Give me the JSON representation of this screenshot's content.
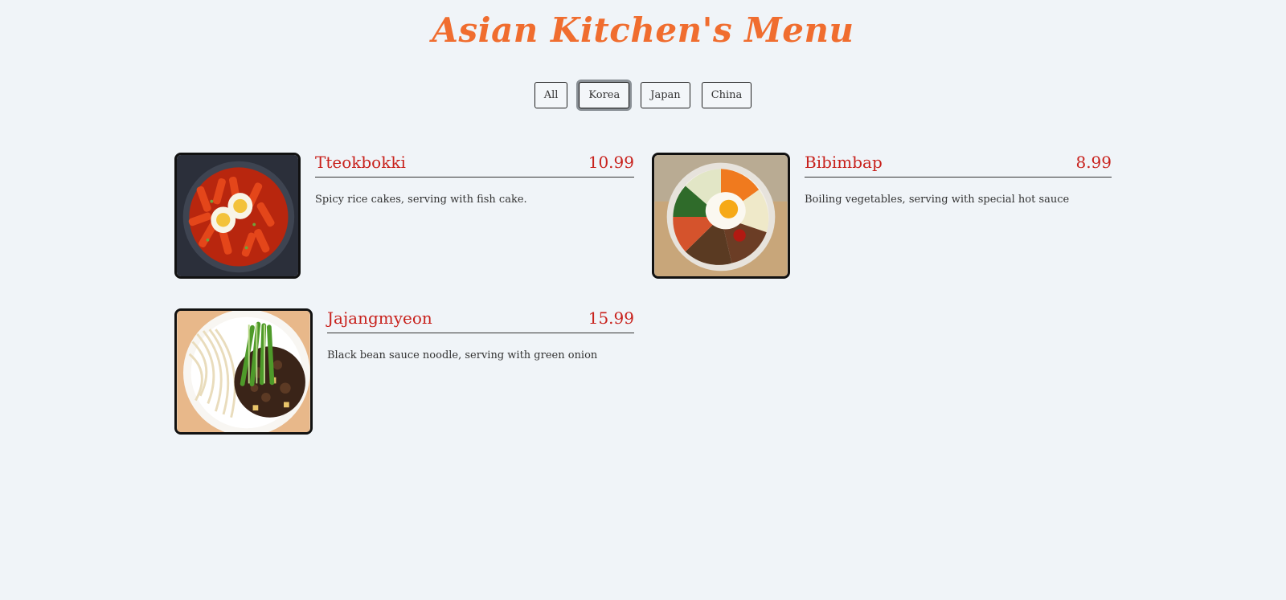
{
  "title": "Asian Kitchen's Menu",
  "filters": [
    "All",
    "Korea",
    "Japan",
    "China"
  ],
  "active_filter": "Korea",
  "items": [
    {
      "name": "Tteokbokki",
      "price": "10.99",
      "desc": "Spicy rice cakes, serving with fish cake.",
      "image": "tteokbokki-photo"
    },
    {
      "name": "Bibimbap",
      "price": "8.99",
      "desc": "Boiling vegetables, serving with special hot sauce",
      "image": "bibimbap-photo"
    },
    {
      "name": "Jajangmyeon",
      "price": "15.99",
      "desc": "Black bean sauce noodle, serving with green onion",
      "image": "jajangmyeon-photo"
    }
  ],
  "colors": {
    "title": "#f06d2f",
    "item_text": "#c8211c",
    "background": "#f0f4f8"
  }
}
